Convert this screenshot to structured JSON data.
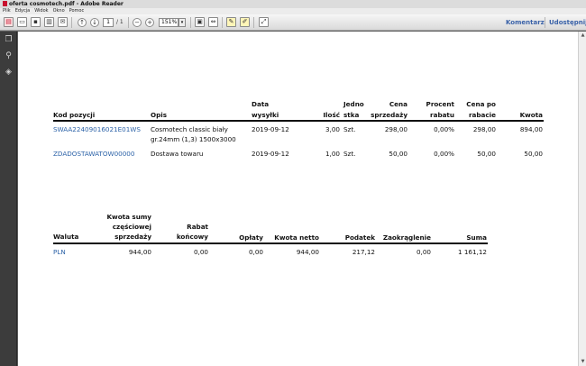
{
  "window": {
    "title": "oferta cosmotech.pdf - Adobe Reader"
  },
  "menu": [
    "Plik",
    "Edycja",
    "Widok",
    "Okno",
    "Pomoc"
  ],
  "toolbar": {
    "page_current": "1",
    "page_total": "/ 1",
    "zoom": "151%",
    "comment_label": "Komentarz",
    "share_label": "Udostępnij"
  },
  "items_table": {
    "headers": {
      "code": "Kod pozycji",
      "desc": "Opis",
      "date_1": "Data",
      "date_2": "wysyłki",
      "qty": "Ilość",
      "unit_1": "Jedno",
      "unit_2": "stka",
      "price_1": "Cena",
      "price_2": "sprzedaży",
      "disc_1": "Procent",
      "disc_2": "rabatu",
      "after_1": "Cena po",
      "after_2": "rabacie",
      "amount": "Kwota"
    },
    "rows": [
      {
        "code": "SWAA22409016021E01WS",
        "desc_1": "Cosmotech classic biały",
        "desc_2": "gr.24mm (1,3) 1500x3000",
        "date": "2019-09-12",
        "qty": "3,00",
        "unit": "Szt.",
        "price": "298,00",
        "disc": "0,00%",
        "after": "298,00",
        "amount": "894,00"
      },
      {
        "code": "ZDADOSTAWATOW00000",
        "desc_1": "Dostawa towaru",
        "desc_2": "",
        "date": "2019-09-12",
        "qty": "1,00",
        "unit": "Szt.",
        "price": "50,00",
        "disc": "0,00%",
        "after": "50,00",
        "amount": "50,00"
      }
    ]
  },
  "summary_table": {
    "headers": {
      "currency": "Waluta",
      "subtotal_1": "Kwota sumy",
      "subtotal_2": "częściowej",
      "subtotal_3": "sprzedaży",
      "rebate_1": "Rabat",
      "rebate_2": "końcowy",
      "fees": "Opłaty",
      "net": "Kwota netto",
      "tax": "Podatek",
      "rounding": "Zaokrąglenie",
      "total": "Suma"
    },
    "row": {
      "currency": "PLN",
      "subtotal": "944,00",
      "rebate": "0,00",
      "fees": "0,00",
      "net": "944,00",
      "tax": "217,12",
      "rounding": "0,00",
      "total": "1 161,12"
    }
  }
}
